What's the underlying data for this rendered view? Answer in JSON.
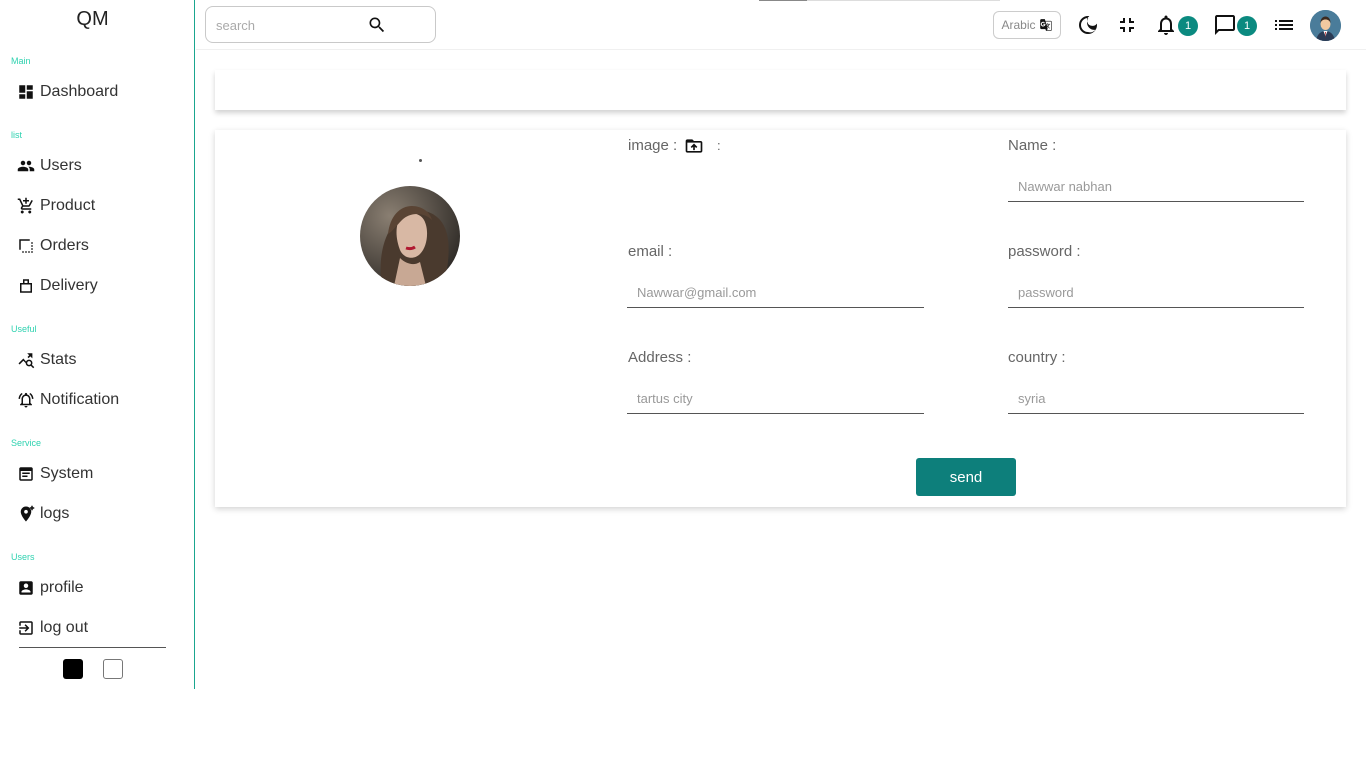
{
  "sidebar": {
    "logo": "QM",
    "sections": {
      "main": "Main",
      "list": "list",
      "useful": "Useful",
      "service": "Service",
      "users": "Users"
    },
    "items": {
      "dashboard": "Dashboard",
      "users": "Users",
      "product": "Product",
      "orders": "Orders",
      "delivery": "Delivery",
      "stats": "Stats",
      "notification": "Notification",
      "system": "System",
      "logs": "logs",
      "profile": "profile",
      "logout": "log out"
    }
  },
  "topbar": {
    "search_placeholder": "search",
    "language": "Arabic",
    "notification_count": "1",
    "message_count": "1"
  },
  "form": {
    "image_label": "image :",
    "image_colon": ":",
    "name_label": "Name :",
    "name_placeholder": "Nawwar nabhan",
    "email_label": "email :",
    "email_placeholder": "Nawwar@gmail.com",
    "password_label": "password :",
    "password_placeholder": "password",
    "address_label": "Address :",
    "address_placeholder": "tartus city",
    "country_label": "country :",
    "country_placeholder": "syria",
    "send_label": "send"
  },
  "colors": {
    "accent": "#0d7f7b",
    "section_label": "#2fd2b0",
    "sidebar_border": "#1aa68f"
  }
}
